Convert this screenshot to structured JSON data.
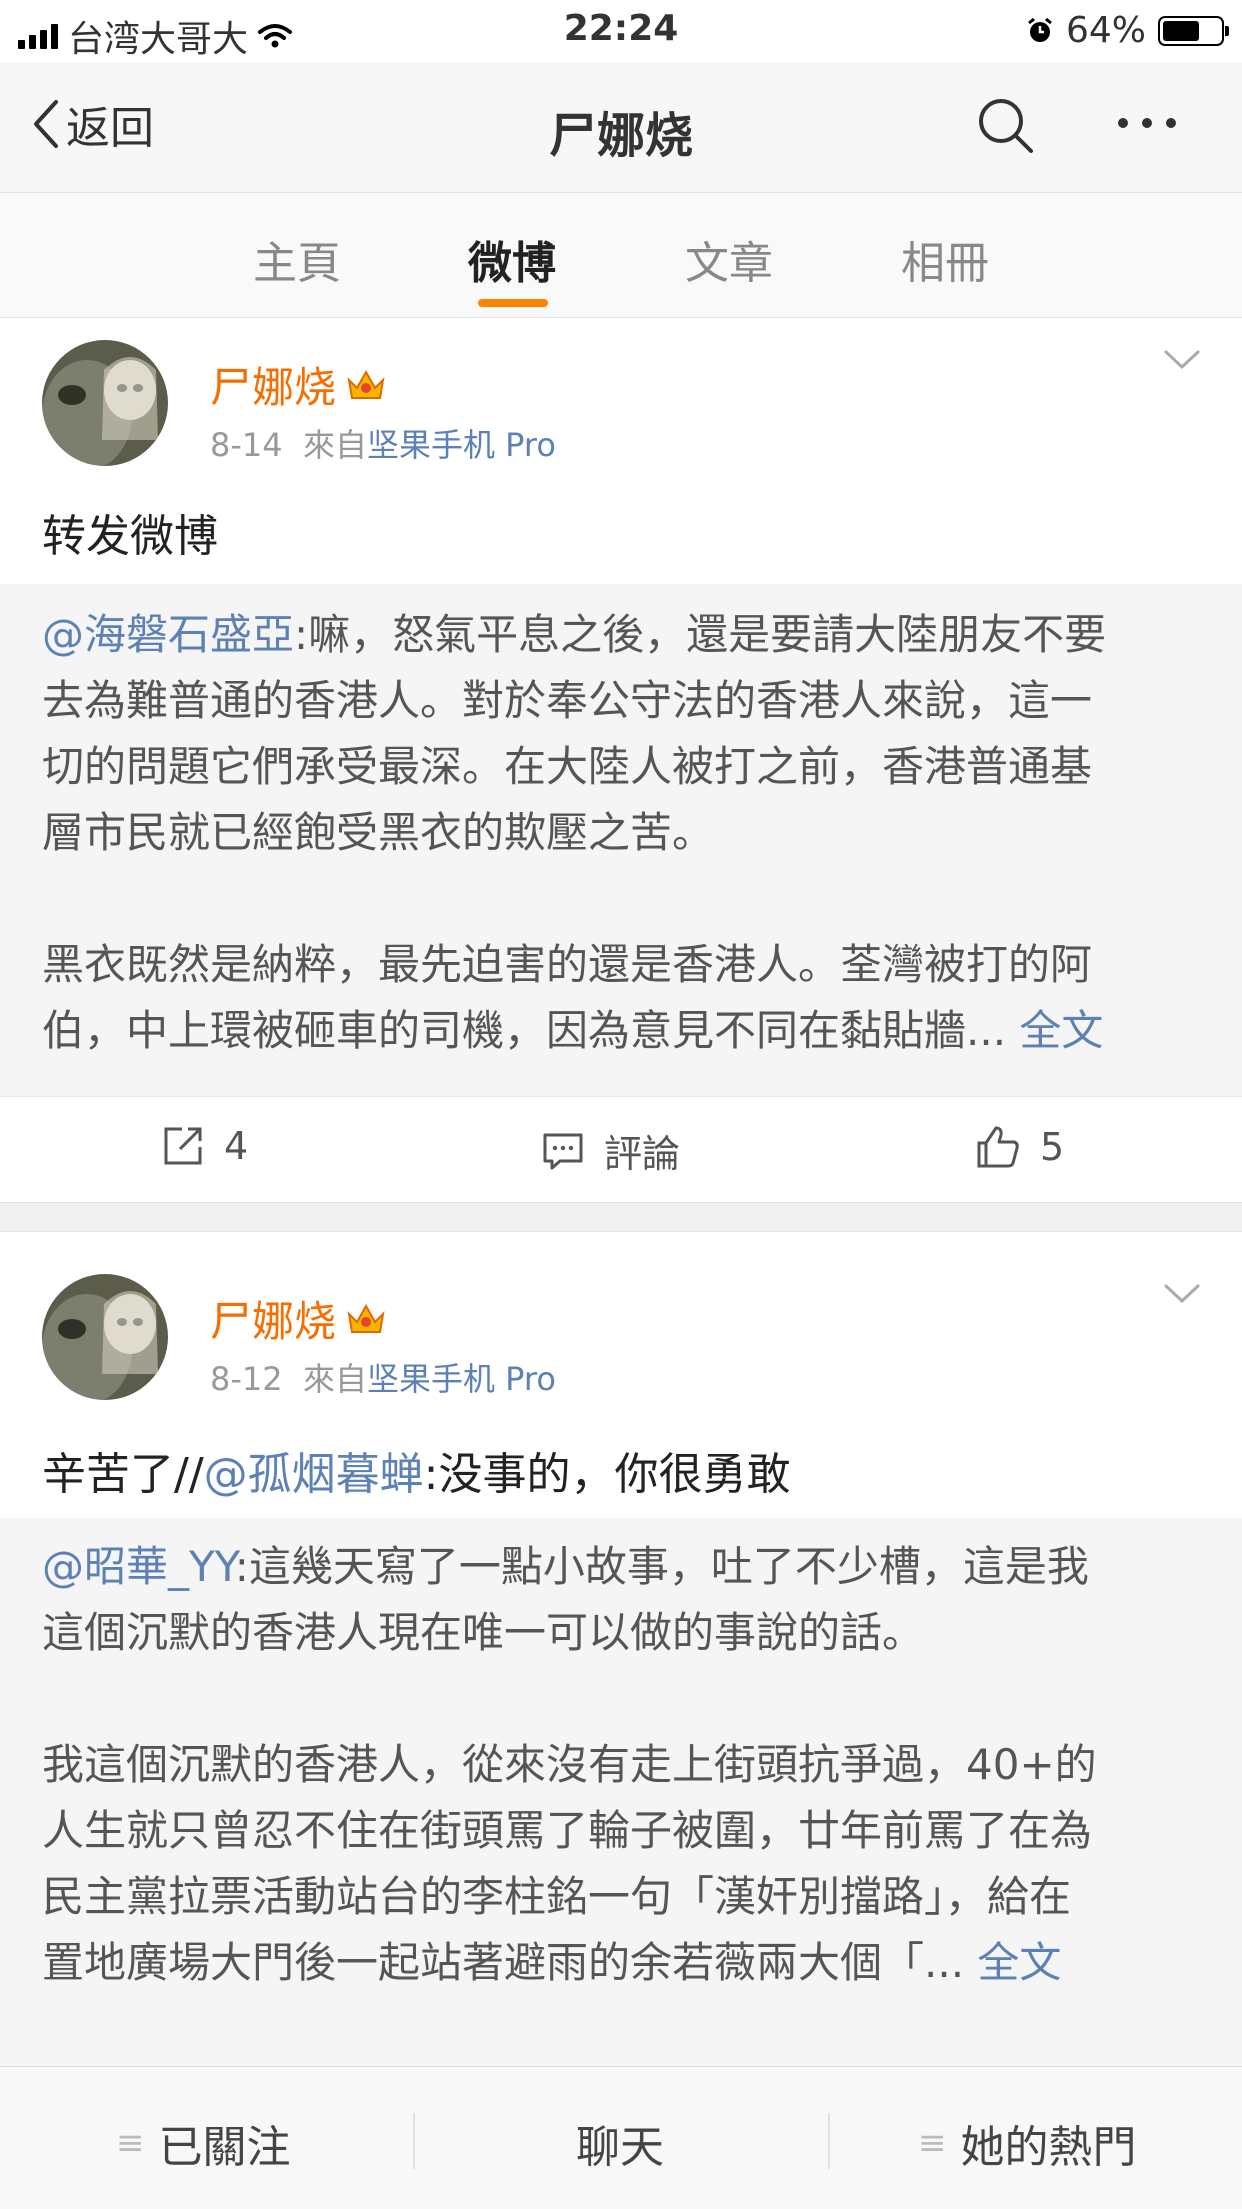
{
  "status": {
    "carrier": "台湾大哥大",
    "time": "22:24",
    "battery": "64%",
    "battery_level": 0.64
  },
  "navbar": {
    "back_label": "返回",
    "title": "尸娜烧"
  },
  "tabs": [
    {
      "label": "主頁"
    },
    {
      "label": "微博"
    },
    {
      "label": "文章"
    },
    {
      "label": "相冊"
    }
  ],
  "active_tab": 1,
  "posts": [
    {
      "name": "尸娜烧",
      "date": "8-14",
      "from": "來自",
      "source": "坚果手机 Pro",
      "text": "转发微博",
      "quote_mention": "@海磐石盛亞",
      "quote_lines": [
        ":嘛，怒氣平息之後，還是要請大陸朋友不要",
        "去為難普通的香港人。對於奉公守法的香港人來說，這一",
        "切的問題它們承受最深。在大陸人被打之前，香港普通基",
        "層市民就已經飽受黑衣的欺壓之苦。",
        "",
        "黑衣既然是納粹，最先迫害的還是香港人。荃灣被打的阿",
        "伯，中上環被砸車的司機，因為意見不同在黏貼牆... "
      ],
      "full_text": "全文",
      "repost_count": "4",
      "comment_label": "評論",
      "like_count": "5"
    },
    {
      "name": "尸娜烧",
      "date": "8-12",
      "from": "來自",
      "source": "坚果手机 Pro",
      "text_prefix": "辛苦了//",
      "text_mention": "@孤烟暮蝉",
      "text_suffix": ":没事的，你很勇敢",
      "quote_mention": "@昭華_YY",
      "quote_lines": [
        ":這幾天寫了一點小故事，吐了不少槽，這是我",
        "這個沉默的香港人現在唯一可以做的事說的話。",
        "",
        "我這個沉默的香港人，從來沒有走上街頭抗爭過，40+的",
        "人生就只曾忍不住在街頭罵了輪子被圍，廿年前罵了在為",
        "民主黨拉票活動站台的李柱銘一句「漢奸別擋路」，給在",
        "置地廣場大門後一起站著避雨的余若薇兩大個「... "
      ],
      "full_text": "全文"
    }
  ],
  "bottom": {
    "following": "已關注",
    "chat": "聊天",
    "hot": "她的熱門"
  }
}
